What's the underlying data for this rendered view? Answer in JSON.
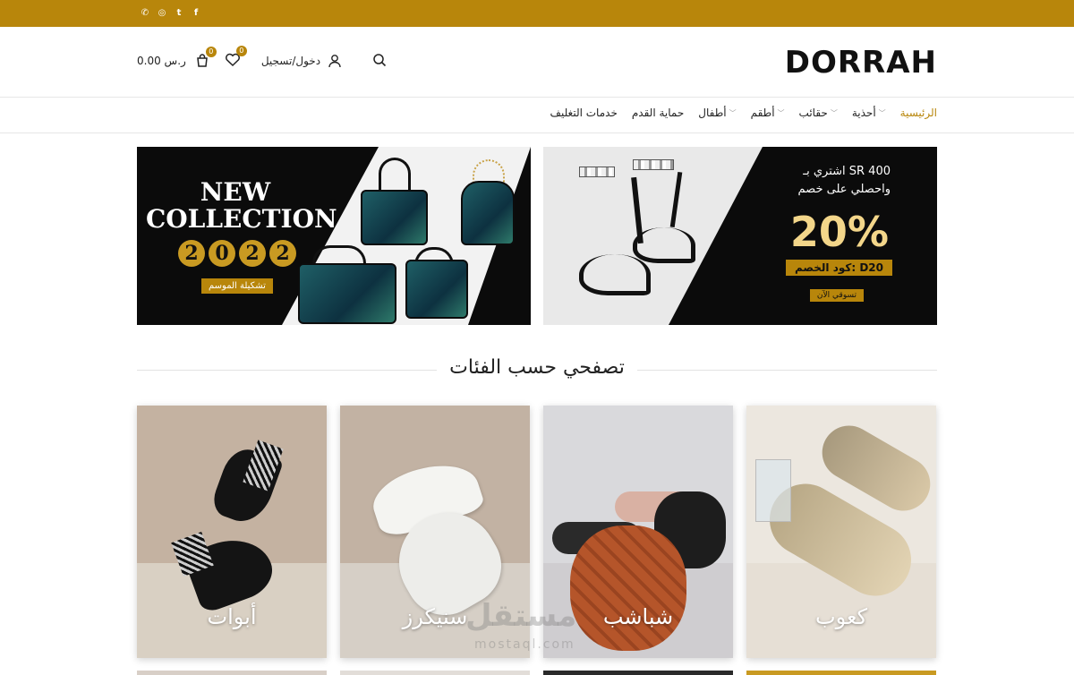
{
  "topbar": {
    "social": [
      {
        "icon": "facebook-icon",
        "glyph": "f"
      },
      {
        "icon": "twitter-icon",
        "glyph": "t"
      },
      {
        "icon": "instagram-icon",
        "glyph": "◎"
      },
      {
        "icon": "whatsapp-icon",
        "glyph": "✆"
      }
    ],
    "color": "#b8860b"
  },
  "header": {
    "logo": "DORRAH",
    "cart_total": "0.00 ر.س",
    "cart_count": "0",
    "wishlist_count": "0",
    "account_label": "دخول/تسجيل"
  },
  "nav": {
    "items": [
      {
        "label": "الرئيسية",
        "active": true,
        "dropdown": false
      },
      {
        "label": "أحذية",
        "active": false,
        "dropdown": true
      },
      {
        "label": "حقائب",
        "active": false,
        "dropdown": true
      },
      {
        "label": "أطقم",
        "active": false,
        "dropdown": true
      },
      {
        "label": "أطفال",
        "active": false,
        "dropdown": true
      },
      {
        "label": "حماية القدم",
        "active": false,
        "dropdown": false
      },
      {
        "label": "خدمات التغليف",
        "active": false,
        "dropdown": false
      }
    ]
  },
  "banners": {
    "left": {
      "line1": "NEW",
      "line2": "COLLECTION",
      "year_digits": [
        "2",
        "0",
        "2",
        "2"
      ],
      "tag": "تشكيلة الموسم"
    },
    "right": {
      "line1": "اشتري بـ SR 400",
      "line2": "واحصلي على خصم",
      "percent": "20%",
      "code": "كود الخصم: D20",
      "cta": "تسوقي الآن"
    }
  },
  "categories_section": {
    "title": "تصفحي حسب الفئات",
    "items": [
      {
        "label": "أبوات"
      },
      {
        "label": "سنيكرز"
      },
      {
        "label": "شباشب"
      },
      {
        "label": "كعوب"
      }
    ]
  },
  "watermark": {
    "text": "مستقل",
    "sub": "mostaql.com"
  }
}
